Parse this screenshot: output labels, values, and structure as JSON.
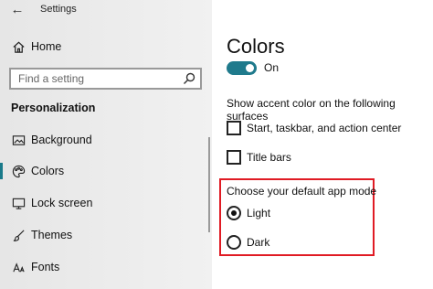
{
  "window": {
    "back_icon": "back-arrow-icon",
    "title": "Settings"
  },
  "sidebar": {
    "home": {
      "label": "Home",
      "icon": "home-icon"
    },
    "search": {
      "placeholder": "Find a setting",
      "icon": "search-icon"
    },
    "section_title": "Personalization",
    "items": [
      {
        "label": "Background",
        "icon": "background-image-icon",
        "active": false
      },
      {
        "label": "Colors",
        "icon": "palette-icon",
        "active": true
      },
      {
        "label": "Lock screen",
        "icon": "lock-screen-icon",
        "active": false
      },
      {
        "label": "Themes",
        "icon": "brush-icon",
        "active": false
      },
      {
        "label": "Fonts",
        "icon": "font-icon",
        "active": false
      }
    ]
  },
  "main": {
    "title": "Colors",
    "toggle": {
      "state_label": "On",
      "on": true
    },
    "accent_description": "Show accent color on the following surfaces",
    "checkboxes": [
      {
        "label": "Start, taskbar, and action center",
        "checked": false
      },
      {
        "label": "Title bars",
        "checked": false
      }
    ],
    "app_mode": {
      "heading": "Choose your default app mode",
      "options": [
        {
          "label": "Light",
          "selected": true
        },
        {
          "label": "Dark",
          "selected": false
        }
      ]
    }
  },
  "colors": {
    "accent": "#1f7a8c",
    "highlight_border": "#e01b24",
    "sidebar_bg": "#e9e9e9"
  }
}
